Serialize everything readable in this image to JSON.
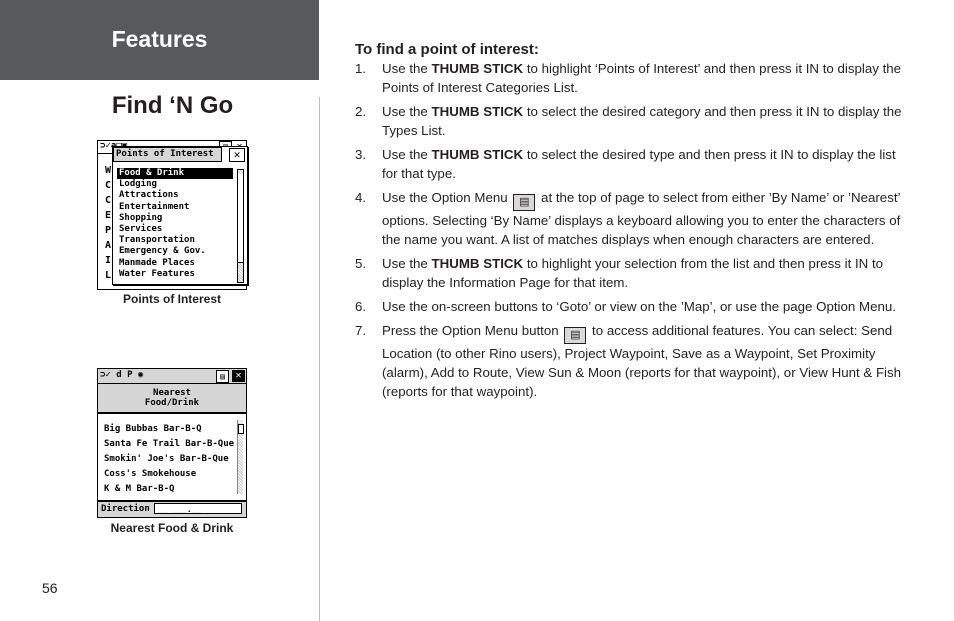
{
  "header": {
    "section": "Features",
    "title": "Find ‘N Go"
  },
  "page_number": "56",
  "screens": {
    "poi": {
      "caption": "Points of Interest",
      "status_icons": "⊃✓а□▣",
      "menu_icon": "option-menu-icon",
      "popup_title": "Points of Interest",
      "bg_letters": [
        "W",
        "C",
        "C",
        "E",
        "P",
        "A",
        "I",
        "L"
      ],
      "items": [
        "Food & Drink",
        "Lodging",
        "Attractions",
        "Entertainment",
        "Shopping",
        "Services",
        "Transportation",
        "Emergency & Gov.",
        "Manmade Places",
        "Water Features"
      ],
      "selected_index": 0
    },
    "nearest": {
      "caption": "Nearest Food & Drink",
      "status_icons": "⊃✓ d P ◉",
      "heading_line1": "Nearest",
      "heading_line2": "Food/Drink",
      "items": [
        "Big Bubbas Bar-B-Q",
        "Santa Fe Trail Bar-B-Que",
        "Smokin' Joe's Bar-B-Que",
        "Coss's Smokehouse",
        "K & M Bar-B-Q"
      ],
      "footer_label": "Direction",
      "footer_value": "__        ___.__"
    }
  },
  "instructions": {
    "heading": "To find a point of interest:",
    "steps": [
      {
        "num": "1.",
        "pre": "Use the ",
        "bold": "THUMB STICK",
        "post": " to highlight ‘Points of Interest’ and then press it IN to display the Points of Interest Categories List."
      },
      {
        "num": "2.",
        "pre": "Use the ",
        "bold": "THUMB STICK",
        "post": " to select the desired category and then press it IN to display the Types List."
      },
      {
        "num": "3.",
        "pre": "Use the ",
        "bold": "THUMB STICK",
        "post": " to select the desired type and then press it IN to display the list for that type."
      },
      {
        "num": "4.",
        "pre": "Use the Option Menu ",
        "post": " at the top of page to select from either ’By Name’ or ’Nearest’ options.  Selecting ‘By Name’ displays a keyboard allowing you to enter the characters of the name you want.  A list of matches displays when enough characters are entered."
      },
      {
        "num": "5.",
        "pre": "Use the ",
        "bold": "THUMB STICK",
        "post": " to highlight your selection from the list and then press it IN to display the Information Page for that item."
      },
      {
        "num": "6.",
        "text": "Use the on-screen buttons to ‘Goto’ or view on the ’Map’, or use the page Option Menu."
      },
      {
        "num": "7.",
        "pre": "Press the Option Menu button ",
        "post": " to access additional features.  You can select: Send Location (to other Rino users), Project Waypoint, Save as a Waypoint, Set Proximity (alarm), Add to Route, View Sun & Moon (reports for that waypoint), or View Hunt & Fish (reports for that waypoint)."
      }
    ],
    "option_icon_glyph": "▤"
  }
}
